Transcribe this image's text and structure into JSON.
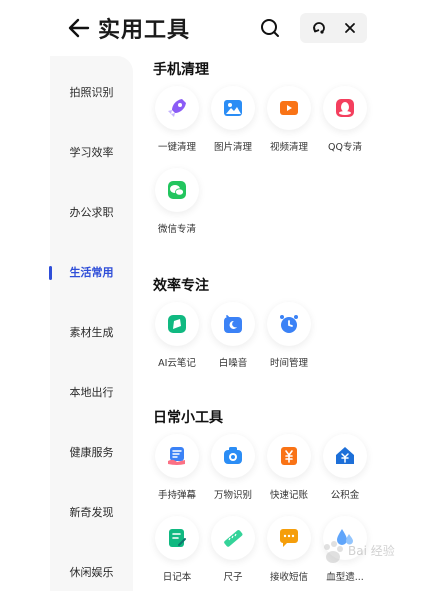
{
  "header": {
    "title": "实用工具"
  },
  "sidebar": {
    "items": [
      "拍照识别",
      "学习效率",
      "办公求职",
      "生活常用",
      "素材生成",
      "本地出行",
      "健康服务",
      "新奇发现",
      "休闲娱乐"
    ],
    "active_index": 3
  },
  "sections": [
    {
      "title": "手机清理",
      "tools": [
        "一键清理",
        "图片清理",
        "视频清理",
        "QQ专清",
        "微信专清"
      ]
    },
    {
      "title": "效率专注",
      "tools": [
        "AI云笔记",
        "白噪音",
        "时间管理"
      ]
    },
    {
      "title": "日常小工具",
      "tools": [
        "手持弹幕",
        "万物识别",
        "快速记账",
        "公积金",
        "日记本",
        "尺子",
        "接收短信",
        "血型遗..."
      ]
    }
  ],
  "colors": {
    "accent": "#2f4ed8",
    "sidebar_bg": "#f7f7f7"
  },
  "watermark": {
    "text": "Bai 经验"
  }
}
